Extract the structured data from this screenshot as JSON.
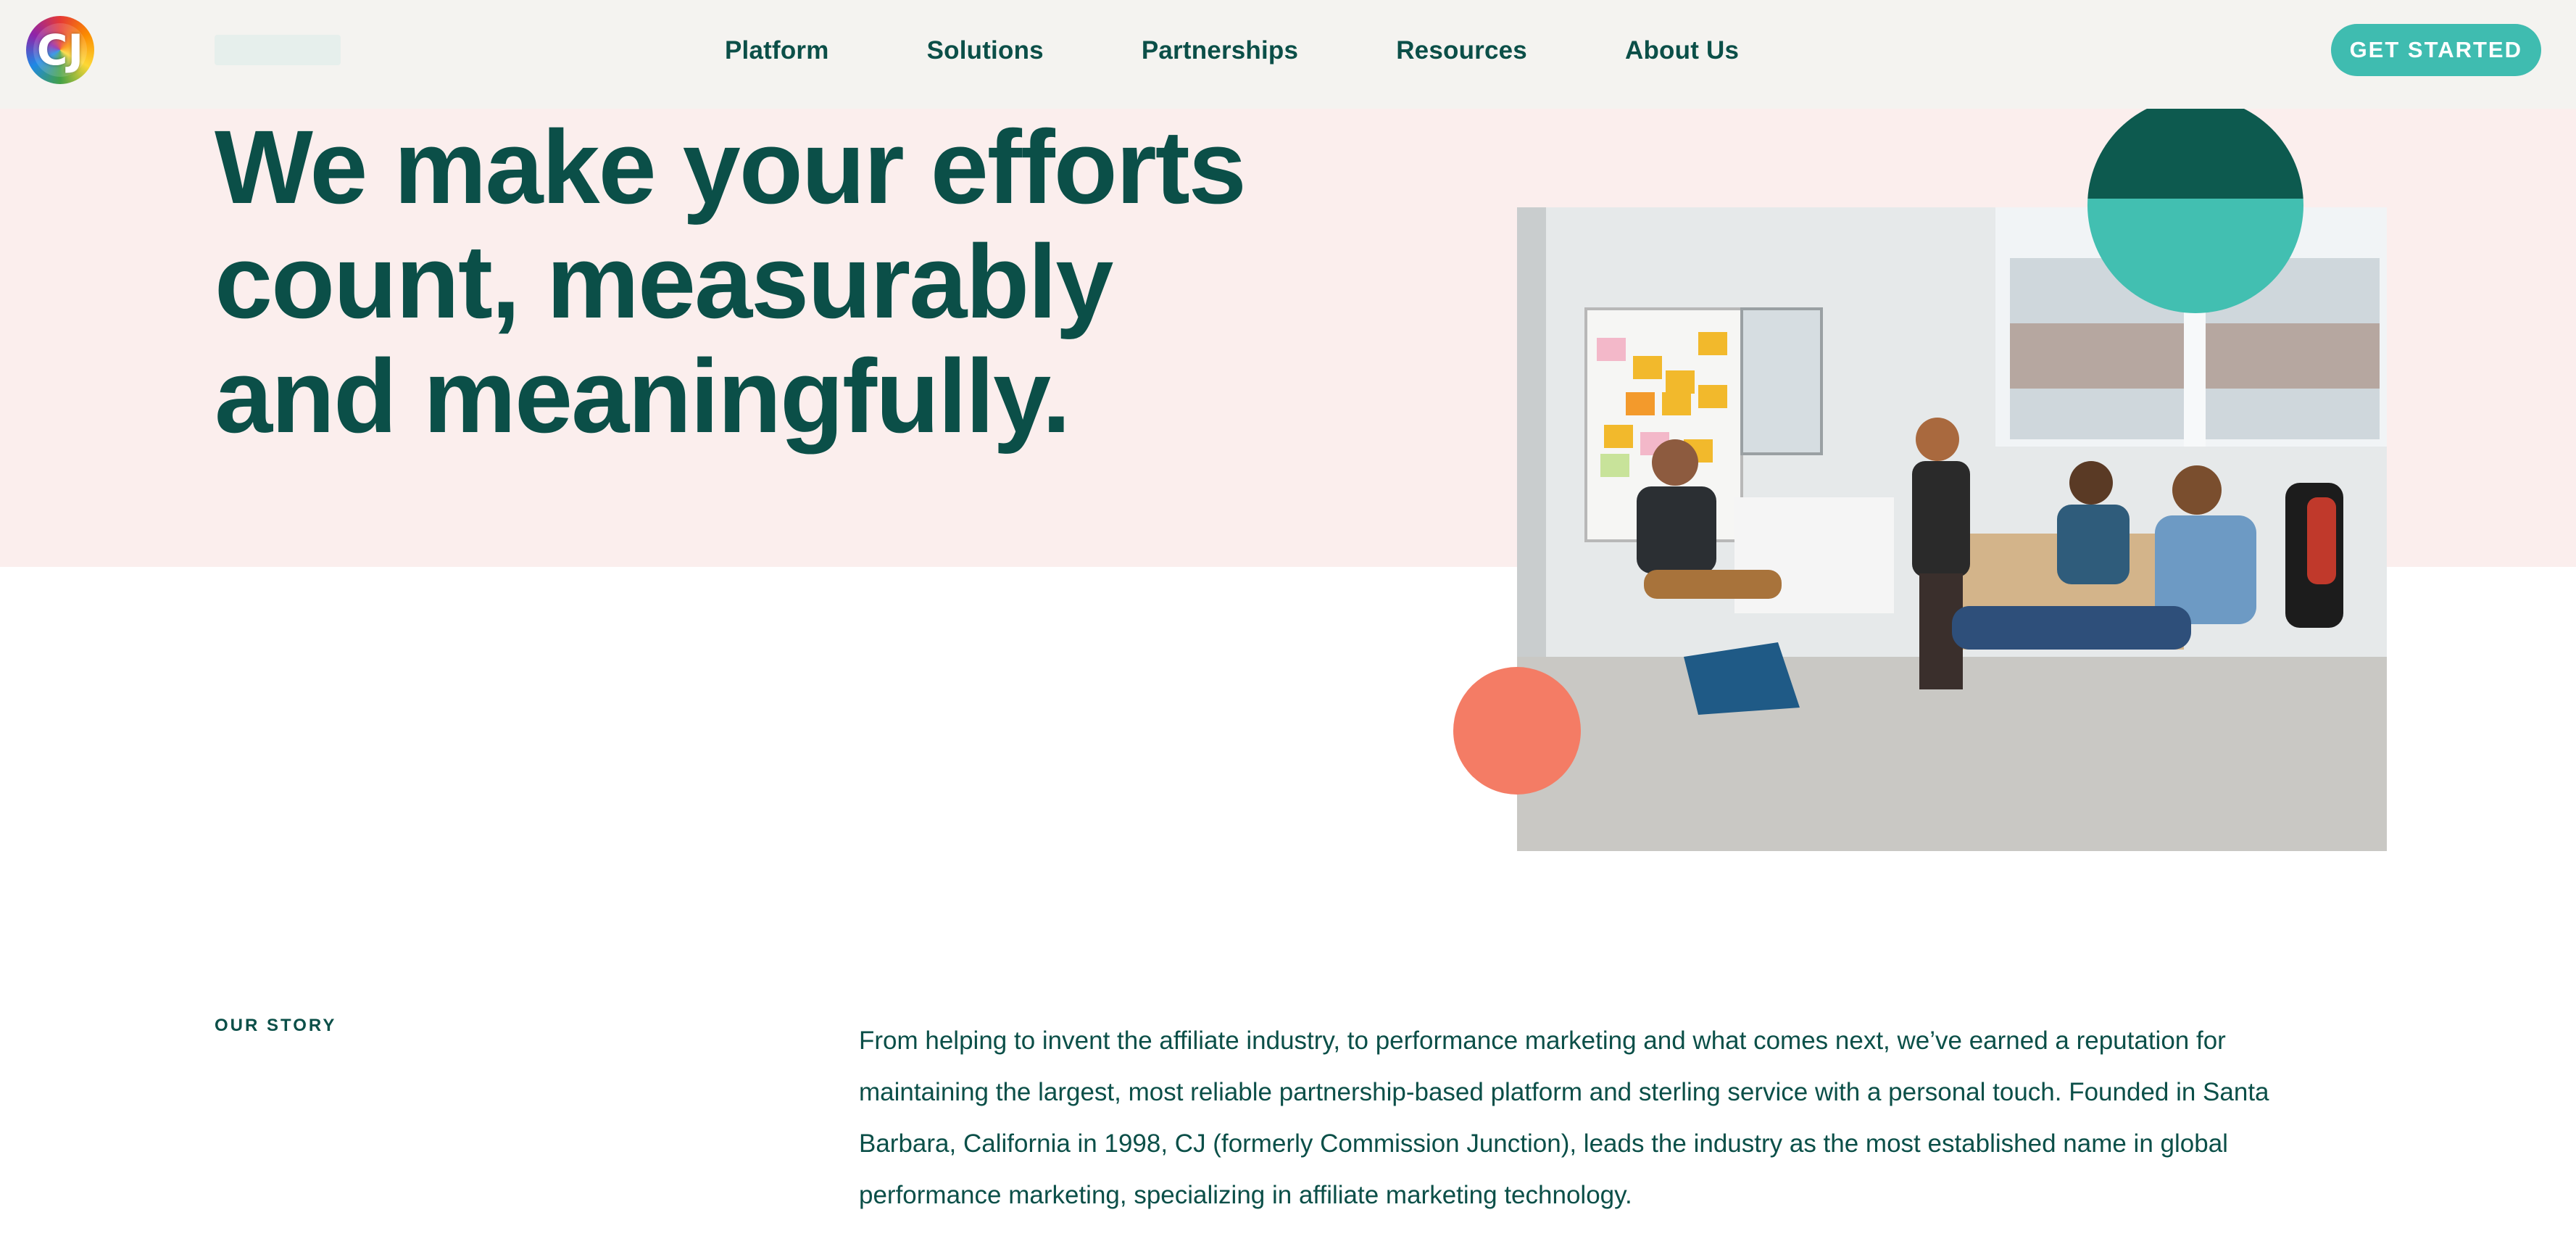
{
  "header": {
    "logo_text": "CJ",
    "nav": [
      "Platform",
      "Solutions",
      "Partnerships",
      "Resources",
      "About Us"
    ],
    "cta_label": "GET STARTED"
  },
  "hero": {
    "headline_lines": [
      "We make your efforts",
      "count, measurably",
      "and meaningfully."
    ],
    "image_alt": "team-meeting-photo"
  },
  "story": {
    "label": "OUR STORY",
    "text": "From helping to invent the affiliate industry, to performance marketing and what comes next, we’ve earned a reputation for maintaining the largest, most reliable partnership-based platform and sterling service with a personal touch. Founded in Santa Barbara, California in 1998, CJ (formerly Commission Junction), leads the industry as the most established name in global performance marketing, specializing in affiliate marketing technology."
  },
  "colors": {
    "brand_dark": "#0b4f48",
    "brand_teal": "#3fbcb0",
    "hero_pink": "#fbeeed",
    "coral": "#f47c65"
  }
}
